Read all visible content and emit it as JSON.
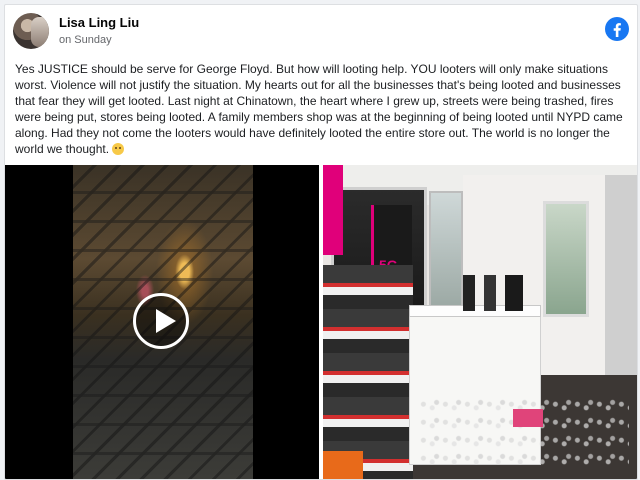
{
  "post": {
    "author": "Lisa Ling Liu",
    "timestamp": "on Sunday",
    "platform_icon": "facebook-icon",
    "body": "Yes JUSTICE should be serve for George Floyd. But how will looting help. YOU looters will only make situations worst. Violence will not justify the situation. My hearts out for all the businesses that's being looted and businesses that fear they will get looted. Last night at Chinatown, the heart where I grew up, streets were being trashed, fires were being put, stores being looted. A family members shop was at the beginning of being looted until NYPD came along. Had they not come the looters would have definitely looted the entire store out. The world is no longer the world we thought.",
    "emoji_icon": "sad-face-emoji-icon"
  },
  "media": {
    "video_play_icon": "play-icon",
    "store_sign_text": "5G"
  },
  "colors": {
    "facebook_blue": "#1877f2",
    "store_magenta": "#e0007a"
  }
}
